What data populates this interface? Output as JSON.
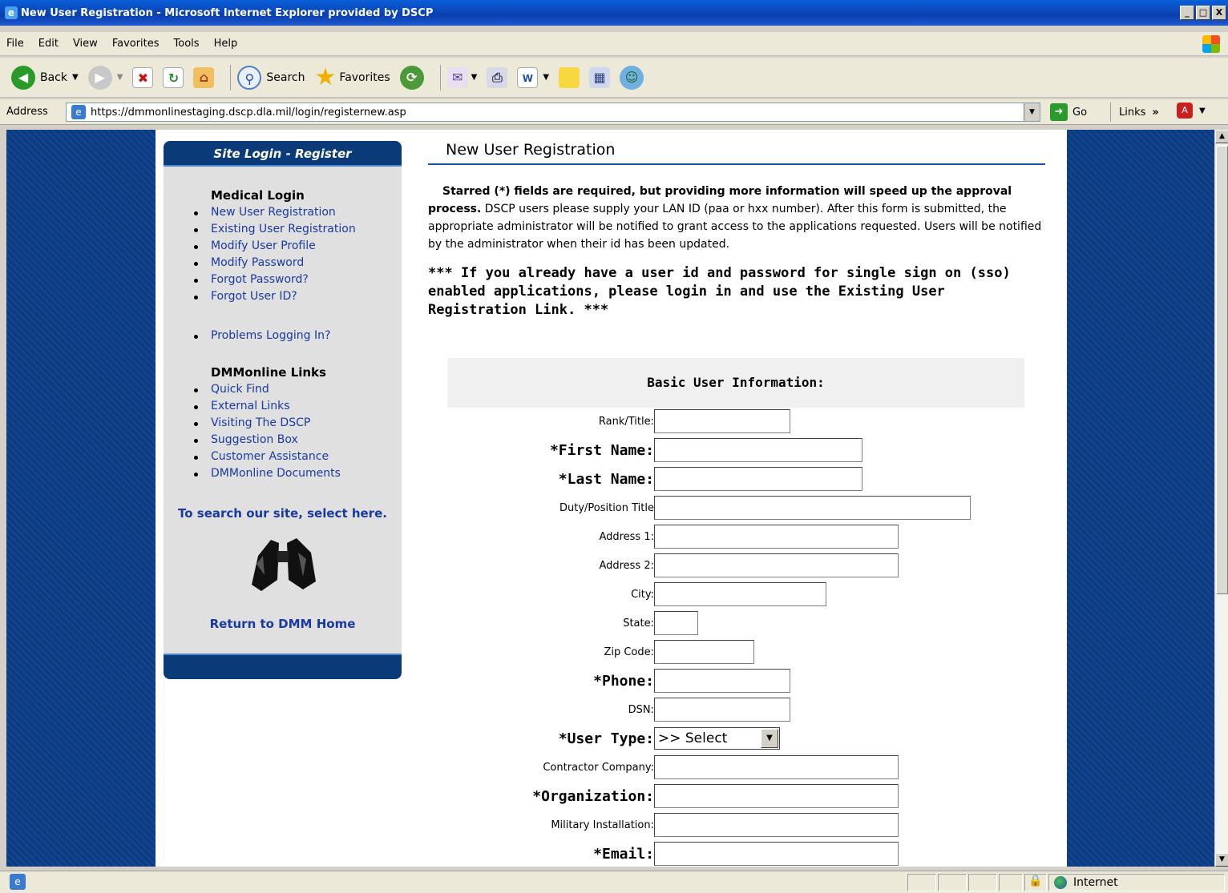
{
  "window": {
    "title": "New User Registration - Microsoft Internet Explorer provided by DSCP",
    "min": "_",
    "max": "□",
    "close": "X"
  },
  "menu": [
    "File",
    "Edit",
    "View",
    "Favorites",
    "Tools",
    "Help"
  ],
  "toolbar": {
    "back": "Back",
    "search": "Search",
    "favorites": "Favorites"
  },
  "address": {
    "label": "Address",
    "url": "https://dmmonlinestaging.dscp.dla.mil/login/registernew.asp",
    "go": "Go",
    "links": "Links"
  },
  "sidebar": {
    "header": "Site Login - Register",
    "medical_title": "Medical Login",
    "medical_links": [
      "New User Registration",
      "Existing User Registration",
      "Modify User Profile",
      "Modify Password",
      "Forgot Password?",
      "Forgot User ID?"
    ],
    "problems": "Problems Logging In?",
    "dmm_title": "DMMonline Links",
    "dmm_links": [
      "Quick Find",
      "External Links",
      "Visiting The DSCP",
      "Suggestion Box",
      "Customer Assistance",
      "DMMonline Documents"
    ],
    "search_text": "To search our site, select here.",
    "return_text": "Return to DMM Home"
  },
  "main": {
    "title": "New User Registration",
    "intro_bold": "Starred (*) fields are required, but providing more information will speed up the approval process.",
    "intro_rest": "DSCP users please supply your LAN ID (paa or hxx number).   After this form is submitted, the appropriate administrator will be notified to grant access to the applications requested.   Users will be notified by the administrator when their id has been updated.",
    "warning": "*** If you already have a user id and password for single sign on (sso) enabled applications, please login in and use the Existing User Registration Link. ***",
    "form_header": "Basic User Information:"
  },
  "form": {
    "fields": [
      {
        "label": "Rank/Title:",
        "required": false
      },
      {
        "label": "*First Name:",
        "required": true
      },
      {
        "label": "*Last Name:",
        "required": true
      },
      {
        "label": "Duty/Position Title",
        "required": false
      },
      {
        "label": "Address 1:",
        "required": false
      },
      {
        "label": "Address 2:",
        "required": false
      },
      {
        "label": "City:",
        "required": false
      },
      {
        "label": "State:",
        "required": false
      },
      {
        "label": "Zip Code:",
        "required": false
      },
      {
        "label": "*Phone:",
        "required": true
      },
      {
        "label": "DSN:",
        "required": false
      },
      {
        "label": "*User Type:",
        "required": true
      },
      {
        "label": "Contractor Company:",
        "required": false
      },
      {
        "label": "*Organization:",
        "required": true
      },
      {
        "label": "Military Installation:",
        "required": false
      },
      {
        "label": "*Email:",
        "required": true
      }
    ],
    "user_type_value": ">> Select"
  },
  "status": {
    "zone": "Internet"
  }
}
